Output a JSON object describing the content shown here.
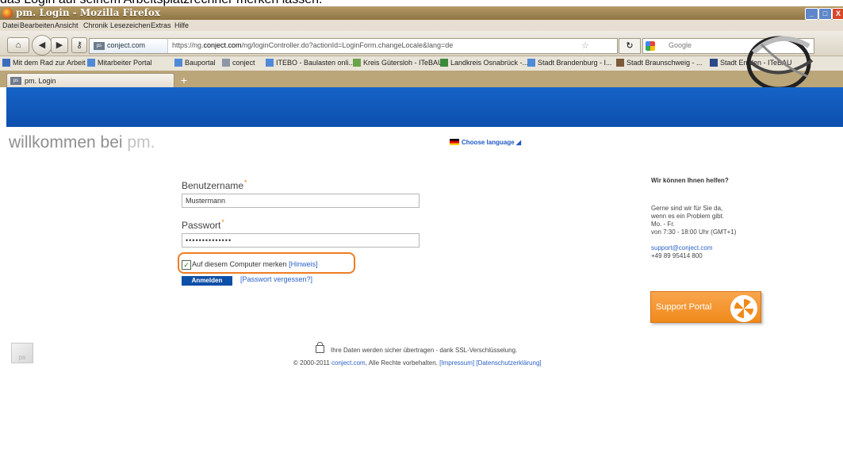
{
  "caption": "das Login auf seinem Arbeitsplatzrechner merken lassen.",
  "window": {
    "title": "pm. Login - Mozilla Firefox",
    "buttons": [
      "_",
      "□",
      "X"
    ]
  },
  "menu": [
    "Datei",
    "Bearbeiten",
    "Ansicht",
    "Chronik",
    "Lesezeichen",
    "Extras",
    "Hilfe"
  ],
  "navbar": {
    "site": "conject.com",
    "url_prefix": "https://ng.",
    "url_domain": "conject.com",
    "url_rest": "/ng/loginController.do?actionId=LoginForm.changeLocale&lang=de",
    "search_placeholder": "Google",
    "star": "☆"
  },
  "bookmarks": [
    "Mit dem Rad zur Arbeit",
    "Mitarbeiter Portal",
    "Bauportal",
    "conject",
    "ITEBO - Baulasten onli...",
    "Kreis Gütersloh - ITeBAU",
    "Landkreis Osnabrück -...",
    "Stadt Brandenburg - I...",
    "Stadt Braunschweig - ...",
    "Stadt Emden - ITeBAU"
  ],
  "tabs": [
    {
      "label": "pm. Login",
      "icon": "ps"
    }
  ],
  "page": {
    "welcome": "willkommen bei ",
    "welcome_brand": "pm.",
    "language_link": "Choose language",
    "username_label": "Benutzername",
    "username_value": "Mustermann",
    "password_label": "Passwort",
    "password_value": "••••••••••••••",
    "remember_text": "Auf diesem Computer merken",
    "remember_hint": "[Hinweis]",
    "remember_checked": true,
    "login_button": "Anmelden",
    "forgot_link": "[Passwort vergessen?]"
  },
  "help": {
    "title": "Wir können Ihnen helfen?",
    "line1": "Gerne sind wir für Sie da,",
    "line2": "wenn es ein Problem gibt.",
    "line3": "Mo. - Fr.",
    "line4": "von 7:30 - 18:00 Uhr (GMT+1)",
    "email": "support@conject.com",
    "phone": "+49 89 95414 800",
    "support_button": "Support Portal"
  },
  "footer": {
    "ssl": "Ihre Daten werden sicher übertragen - dank SSL-Verschlüsselung.",
    "copyright_prefix": "© 2000-2011 ",
    "copyright_link": "conject.com",
    "copyright_suffix": ", Alle Rechte vorbehalten.",
    "impressum": "[Impressum]",
    "privacy": "[Datenschutzerklärung]",
    "logo_text": "ps"
  },
  "colors": {
    "accent_blue": "#0d4fae",
    "highlight_orange": "#ef7c22"
  }
}
